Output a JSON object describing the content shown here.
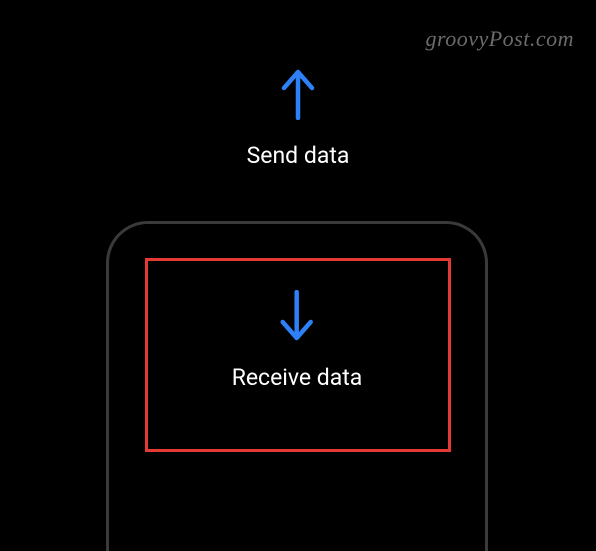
{
  "watermark": "groovyPost.com",
  "send": {
    "label": "Send data"
  },
  "receive": {
    "label": "Receive data"
  },
  "colors": {
    "arrow": "#2d80f5",
    "highlight": "#e53935"
  }
}
